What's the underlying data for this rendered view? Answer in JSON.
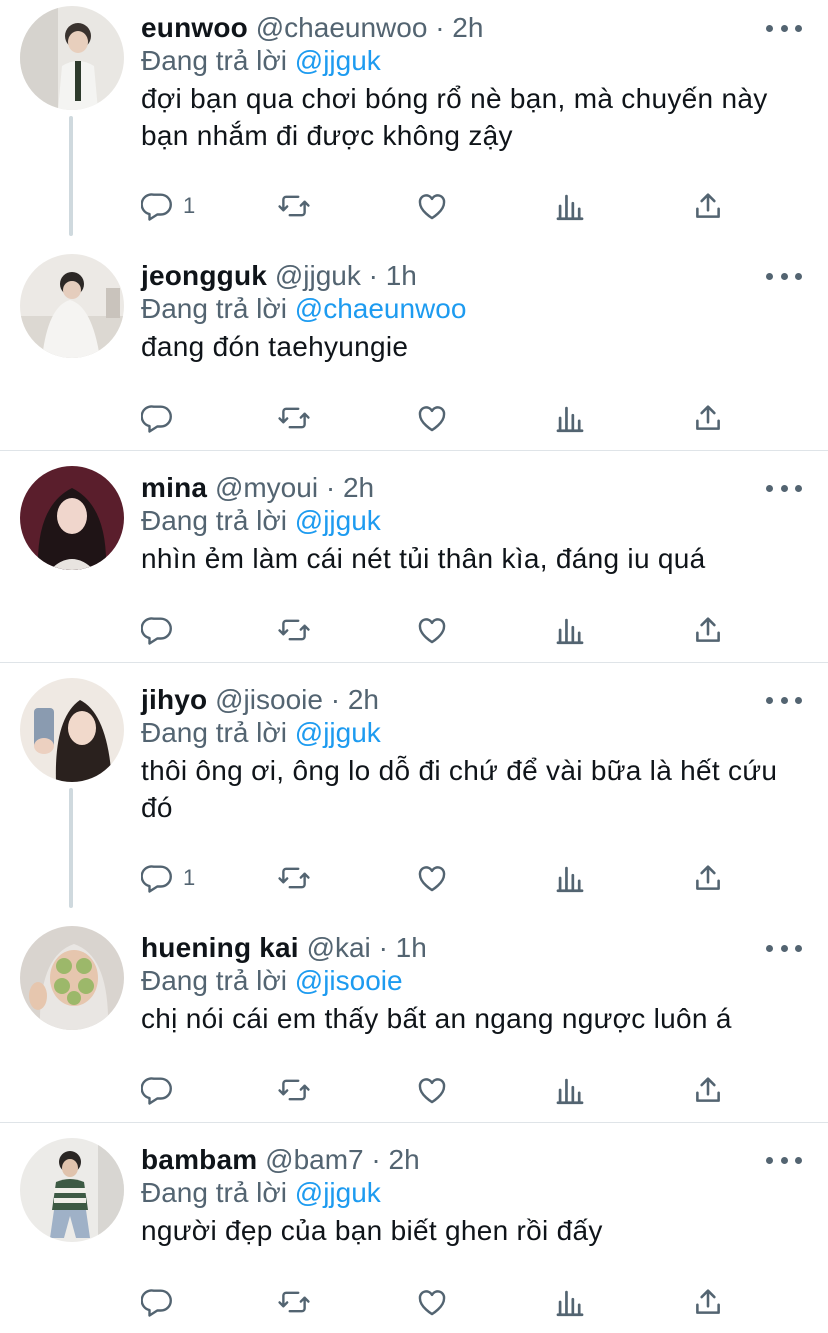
{
  "reply_prefix": "Đang trả lời",
  "colors": {
    "accent": "#1d9bf0",
    "muted": "#536471",
    "text": "#0f1419",
    "thread_line": "#cfd9de",
    "divider": "#dfe4e8"
  },
  "icons": {
    "reply": "reply-icon",
    "retweet": "retweet-icon",
    "like": "heart-icon",
    "analytics": "analytics-icon",
    "share": "share-icon",
    "more": "more-icon"
  },
  "tweets": [
    {
      "name": "eunwoo",
      "handle": "@chaeunwoo",
      "time": "2h",
      "reply_to": "@jjguk",
      "text": "đợi bạn qua chơi bóng rổ nè bạn, mà chuyến này bạn nhắm đi được không zậy",
      "reply_count": "1"
    },
    {
      "name": "jeongguk",
      "handle": "@jjguk",
      "time": "1h",
      "reply_to": "@chaeunwoo",
      "text": "đang đón taehyungie",
      "reply_count": ""
    },
    {
      "name": "mina",
      "handle": "@myoui",
      "time": "2h",
      "reply_to": "@jjguk",
      "text": "nhìn ẻm làm cái nét tủi thân kìa, đáng iu quá",
      "reply_count": ""
    },
    {
      "name": "jihyo",
      "handle": "@jisooie",
      "time": "2h",
      "reply_to": "@jjguk",
      "text": "thôi ông ơi, ông lo dỗ đi chứ để vài bữa là hết cứu đó",
      "reply_count": "1"
    },
    {
      "name": "huening kai",
      "handle": "@kai",
      "time": "1h",
      "reply_to": "@jisooie",
      "text": "chị nói cái em thấy bất an ngang ngược luôn á",
      "reply_count": ""
    },
    {
      "name": "bambam",
      "handle": "@bam7",
      "time": "2h",
      "reply_to": "@jjguk",
      "text": "người đẹp của bạn biết ghen rồi đấy",
      "reply_count": ""
    }
  ]
}
